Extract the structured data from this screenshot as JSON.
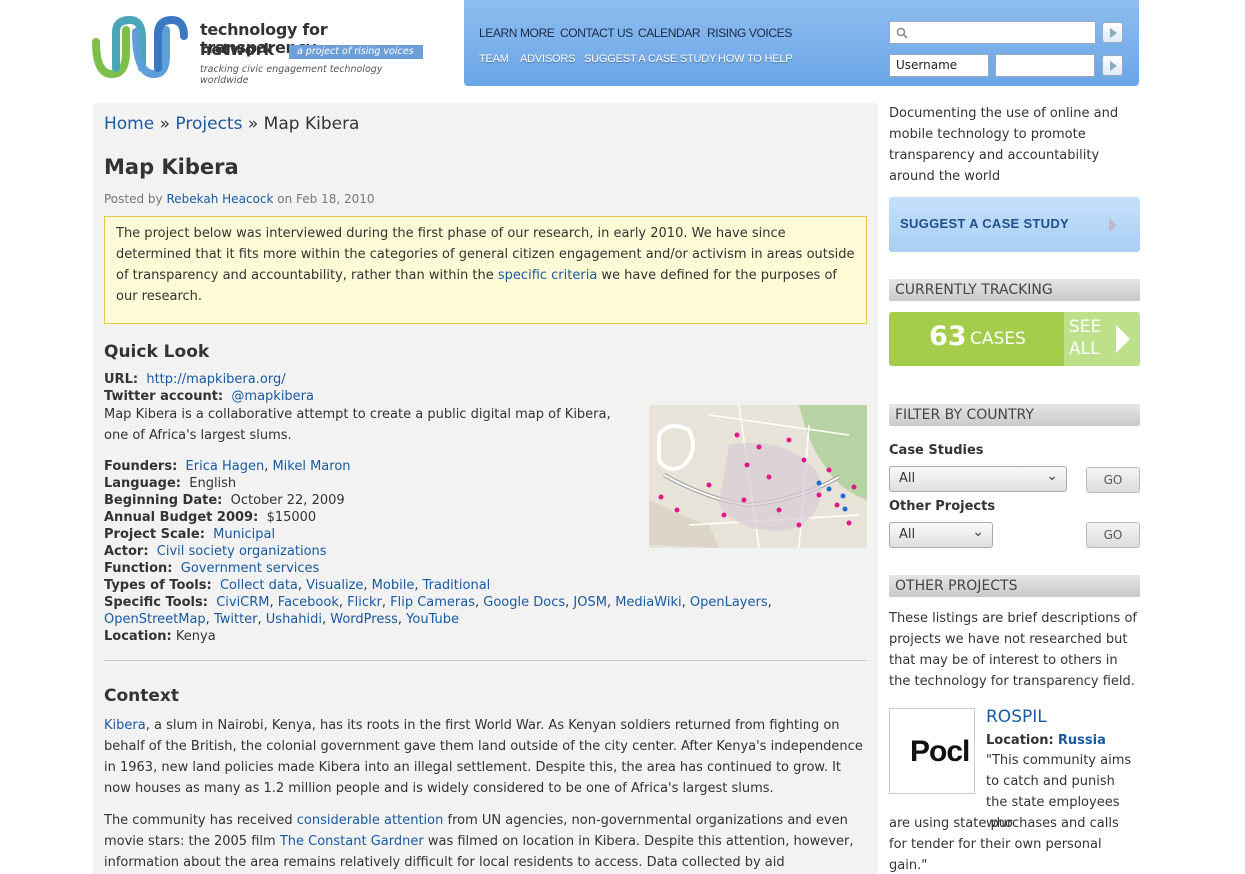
{
  "header": {
    "logo_title": "technology for transparency",
    "logo_title2": "network",
    "logo_tag": "a project of rising voices",
    "logo_sub": "tracking civic engagement technology worldwide",
    "nav_primary": [
      "LEARN MORE",
      "CONTACT US",
      "CALENDAR",
      "RISING VOICES"
    ],
    "nav_secondary": [
      "TEAM",
      "ADVISORS",
      "SUGGEST A CASE STUDY",
      "HOW TO HELP"
    ],
    "search_value": "",
    "username_value": "Username",
    "password_value": ""
  },
  "breadcrumb": {
    "home": "Home",
    "sep": "»",
    "projects": "Projects",
    "current": "Map Kibera"
  },
  "article": {
    "title": "Map Kibera",
    "posted_prefix": "Posted by",
    "author": "Rebekah Heacock",
    "posted_on": "on Feb 18, 2010",
    "notice_pre": "The project below was interviewed during the first phase of our research, in early 2010. We have since determined that it fits more within the categories of general citizen engagement and/or activism in areas outside of transparency and accountability, rather than within the",
    "notice_link": "specific criteria",
    "notice_post": "we have defined for the purposes of our research.",
    "quick_look_heading": "Quick Look",
    "url_label": "URL:",
    "url": "http://mapkibera.org/",
    "twitter_label": "Twitter account:",
    "twitter": "@mapkibera",
    "description": "Map Kibera is a collaborative attempt to create a public digital map of Kibera, one of Africa's largest slums.",
    "founders_label": "Founders:",
    "founders": [
      "Erica Hagen",
      "Mikel Maron"
    ],
    "language_label": "Language:",
    "language": "English",
    "beginning_label": "Beginning Date:",
    "beginning": "October 22, 2009",
    "budget_label": "Annual Budget 2009:",
    "budget": "$15000",
    "scale_label": "Project Scale:",
    "scale": "Municipal",
    "actor_label": "Actor:",
    "actor": "Civil society organizations",
    "function_label": "Function:",
    "function": "Government services",
    "types_label": "Types of Tools:",
    "types": [
      "Collect data",
      "Visualize",
      "Mobile",
      "Traditional"
    ],
    "specific_label": "Specific Tools:",
    "specific_line1": [
      "CiviCRM",
      "Facebook",
      "Flickr",
      "Flip Cameras",
      "Google Docs",
      "JOSM",
      "MediaWiki",
      "OpenLayers"
    ],
    "specific_line2": [
      "OpenStreetMap",
      "Twitter",
      "Ushahidi",
      "WordPress",
      "YouTube"
    ],
    "location_label": "Location:",
    "location": "Kenya",
    "context_heading": "Context",
    "context_p1_link": "Kibera",
    "context_p1": ", a slum in Nairobi, Kenya, has its roots in the first World War. As Kenyan soldiers returned from fighting on behalf of the British, the colonial government gave them land outside of the city center. After Kenya's independence in 1963, new land policies made Kibera into an illegal settlement. Despite this, the area has continued to grow. It now houses as many as 1.2 million people and is widely considered to be one of Africa's largest slums.",
    "context_p2_a": "The community has received",
    "context_p2_link1": "considerable attention",
    "context_p2_b": "from UN agencies, non-governmental organizations and even movie stars: the 2005 film",
    "context_p2_link2": "The Constant Gardner",
    "context_p2_c": "was filmed on location in Kibera. Despite this attention, however, information about the area remains relatively difficult for local residents to access. Data collected by aid"
  },
  "sidebar": {
    "intro": "Documenting the use of online and mobile technology to promote transparency and accountability around the world",
    "suggest_label": "SUGGEST A CASE STUDY",
    "tracking_heading": "CURRENTLY TRACKING",
    "tracking_count": "63",
    "tracking_unit": "CASES",
    "see_all": "SEE ALL",
    "filter_heading": "FILTER BY COUNTRY",
    "case_studies_label": "Case Studies",
    "case_studies_value": "All",
    "other_projects_label": "Other Projects",
    "other_projects_value": "All",
    "go_label": "GO",
    "other_heading": "OTHER PROJECTS",
    "other_text": "These listings are brief descriptions of projects we have not researched but that may be of interest to others in the technology for transparency field.",
    "rospil_logo_text": "Pocl",
    "rospil_name": "ROSPIL",
    "rospil_loc_label": "Location:",
    "rospil_loc": "Russia",
    "rospil_quote_1": "\"This community aims to catch and punish the state employees who",
    "rospil_quote_2": "are using state purchases and calls for tender for their own personal gain.\""
  },
  "colors": {
    "link": "#1a5aa0",
    "nav": "#7bb0ec",
    "tracking": "#a4cd4c",
    "notice_bg": "#fefbd6",
    "notice_border": "#e3c84c"
  }
}
